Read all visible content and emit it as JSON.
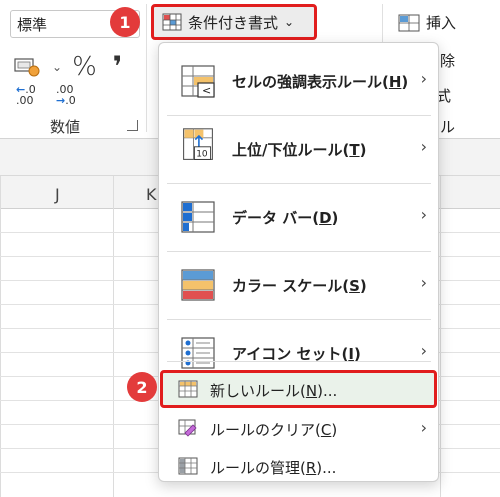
{
  "ribbon": {
    "number_format_value": "標準",
    "percent_symbol": "%",
    "comma_symbol": "❜",
    "increase_decimal": {
      "top": ".0",
      "bottom": ".00"
    },
    "decrease_decimal": {
      "top": ".00",
      "bottom": ".0"
    },
    "group_label": "数値",
    "conditional_formatting_label": "条件付き書式",
    "insert_label": "挿入",
    "delete_partial": "除",
    "format_partial": "式",
    "cells_partial": "ル"
  },
  "columns": [
    "J",
    "K"
  ],
  "badges": {
    "one": "1",
    "two": "2"
  },
  "menu": {
    "items": [
      {
        "label": "セルの強調表示ルール(",
        "key": "H",
        "suffix": ")",
        "has_submenu": true
      },
      {
        "label": "上位/下位ルール(",
        "key": "T",
        "suffix": ")",
        "has_submenu": true
      },
      {
        "label": "データ バー(",
        "key": "D",
        "suffix": ")",
        "has_submenu": true
      },
      {
        "label": "カラー スケール(",
        "key": "S",
        "suffix": ")",
        "has_submenu": true
      },
      {
        "label": "アイコン セット(",
        "key": "I",
        "suffix": ")",
        "has_submenu": true
      }
    ],
    "small_items": [
      {
        "label": "新しいルール(",
        "key": "N",
        "suffix": ")...",
        "has_submenu": false
      },
      {
        "label": "ルールのクリア(",
        "key": "C",
        "suffix": ")",
        "has_submenu": true
      },
      {
        "label": "ルールの管理(",
        "key": "R",
        "suffix": ")...",
        "has_submenu": false
      }
    ],
    "submenu_glyph": "›"
  },
  "colors": {
    "highlight_red": "#e11d1d",
    "badge_red": "#e33b3b",
    "accent_blue": "#1f6fd1"
  }
}
